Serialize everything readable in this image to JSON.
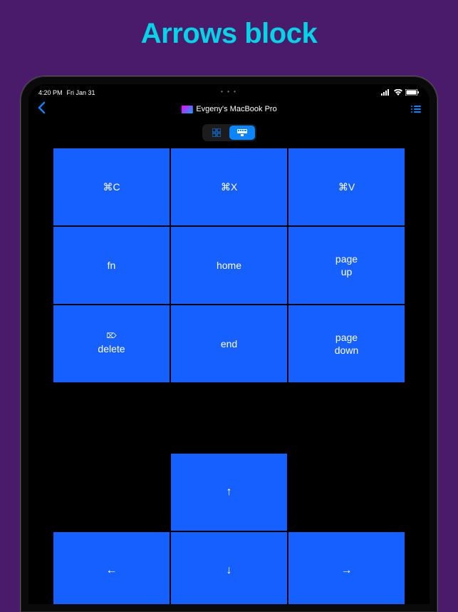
{
  "page": {
    "title": "Arrows block"
  },
  "status": {
    "time": "4:20 PM",
    "date": "Fri Jan 31",
    "dots": "• • •"
  },
  "nav": {
    "device_name": "Evgeny's MacBook Pro"
  },
  "keys": {
    "grid": [
      {
        "label": "⌘C"
      },
      {
        "label": "⌘X"
      },
      {
        "label": "⌘V"
      },
      {
        "label": "fn"
      },
      {
        "label": "home"
      },
      {
        "label": "page\nup"
      },
      {
        "sub": "⌦",
        "label": "delete"
      },
      {
        "label": "end"
      },
      {
        "label": "page\ndown"
      }
    ],
    "arrows": {
      "up": "↑",
      "left": "←",
      "down": "↓",
      "right": "→"
    }
  }
}
